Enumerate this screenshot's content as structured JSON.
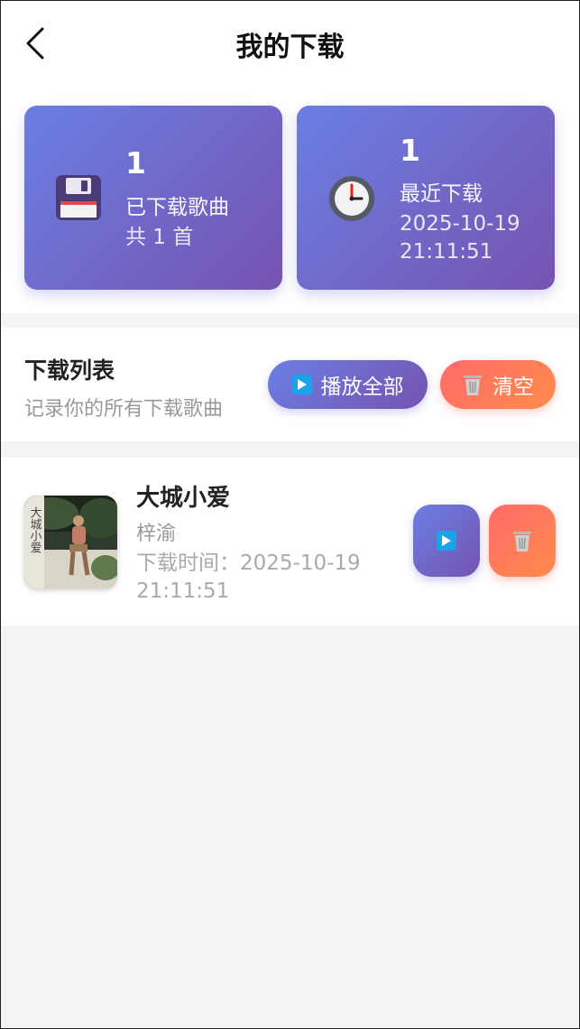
{
  "header": {
    "title": "我的下载",
    "back_icon": "chevron-left-icon"
  },
  "stats": {
    "downloaded": {
      "icon": "floppy-disk-icon",
      "count": "1",
      "label": "已下载歌曲",
      "sub": "共 1 首"
    },
    "recent": {
      "icon": "clock-icon",
      "count": "1",
      "label": "最近下载",
      "date": "2025-10-19",
      "time": "21:11:51"
    }
  },
  "list_header": {
    "title": "下载列表",
    "subtitle": "记录你的所有下载歌曲",
    "play_all_label": "播放全部",
    "clear_label": "清空"
  },
  "songs": [
    {
      "title": "大城小爱",
      "artist": "梓渝",
      "time_prefix": "下载时间：",
      "date": "2025-10-19",
      "time": "21:11:51",
      "cover_text": "大城小爱"
    }
  ],
  "colors": {
    "purple_start": "#6a7fe3",
    "purple_end": "#7653b0",
    "coral_start": "#ff6a6a",
    "coral_end": "#ff8c4a",
    "play_blue": "#1aa3e8"
  }
}
